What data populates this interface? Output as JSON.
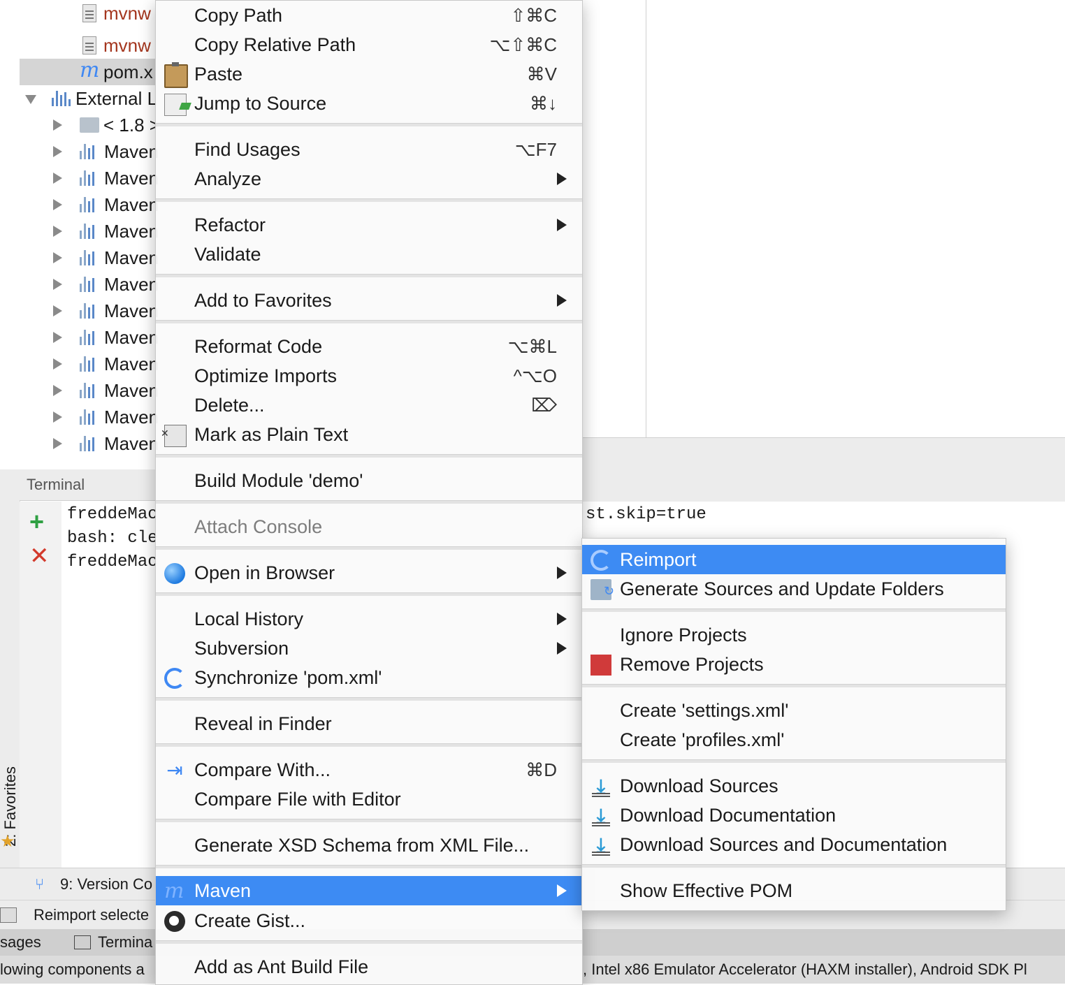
{
  "project_tree": {
    "rows": [
      {
        "label": "mvnw",
        "kind": "file",
        "style": "orange"
      },
      {
        "label": "mvnw",
        "kind": "file",
        "style": "orange"
      },
      {
        "label": "pom.x",
        "kind": "maven",
        "style": "normal",
        "selected": true
      },
      {
        "label": "External L",
        "kind": "lib-root",
        "style": "normal",
        "expanded": true
      },
      {
        "label": "< 1.8 >",
        "kind": "jdk",
        "style": "normal"
      },
      {
        "label": "Maven",
        "kind": "lib"
      },
      {
        "label": "Maven",
        "kind": "lib"
      },
      {
        "label": "Maven",
        "kind": "lib"
      },
      {
        "label": "Maven",
        "kind": "lib"
      },
      {
        "label": "Maven",
        "kind": "lib"
      },
      {
        "label": "Maven",
        "kind": "lib"
      },
      {
        "label": "Maven",
        "kind": "lib"
      },
      {
        "label": "Maven",
        "kind": "lib"
      },
      {
        "label": "Maven",
        "kind": "lib"
      },
      {
        "label": "Maven",
        "kind": "lib"
      },
      {
        "label": "Maven",
        "kind": "lib"
      },
      {
        "label": "Maven",
        "kind": "lib"
      }
    ]
  },
  "terminal": {
    "title": "Terminal",
    "lines": [
      "freddeMac",
      "bash: cle",
      "freddeMac"
    ],
    "right_text": "st.skip=true"
  },
  "bottom": {
    "version_control": "9: Version Co",
    "status": "Reimport selecte",
    "tab_messages": "sages",
    "tab_terminal": "Termina",
    "favorites": "2: Favorites",
    "notification": "lowing components a",
    "notification_right": ", Intel x86 Emulator Accelerator (HAXM installer), Android SDK Pl"
  },
  "context_menu": {
    "items": [
      {
        "label": "Copy Path",
        "shortcut": "⇧⌘C"
      },
      {
        "label": "Copy Relative Path",
        "shortcut": "⌥⇧⌘C"
      },
      {
        "label": "Paste",
        "shortcut": "⌘V",
        "icon": "paste-icon"
      },
      {
        "label": "Jump to Source",
        "shortcut": "⌘↓",
        "icon": "jump-to-source-icon"
      },
      {
        "label": "Find Usages",
        "shortcut": "⌥F7"
      },
      {
        "label": "Analyze",
        "submenu": true
      },
      {
        "label": "Refactor",
        "submenu": true
      },
      {
        "label": "Validate"
      },
      {
        "label": "Add to Favorites",
        "submenu": true
      },
      {
        "label": "Reformat Code",
        "shortcut": "⌥⌘L"
      },
      {
        "label": "Optimize Imports",
        "shortcut": "^⌥O"
      },
      {
        "label": "Delete...",
        "shortcut": "⌦"
      },
      {
        "label": "Mark as Plain Text",
        "icon": "plain-text-icon"
      },
      {
        "label": "Build Module 'demo'"
      },
      {
        "label": "Attach Console",
        "disabled": true
      },
      {
        "label": "Open in Browser",
        "submenu": true,
        "icon": "globe-icon"
      },
      {
        "label": "Local History",
        "submenu": true
      },
      {
        "label": "Subversion",
        "submenu": true
      },
      {
        "label": "Synchronize 'pom.xml'",
        "icon": "sync-icon"
      },
      {
        "label": "Reveal in Finder"
      },
      {
        "label": "Compare With...",
        "shortcut": "⌘D",
        "icon": "compare-icon"
      },
      {
        "label": "Compare File with Editor"
      },
      {
        "label": "Generate XSD Schema from XML File..."
      },
      {
        "label": "Maven",
        "submenu": true,
        "highlighted": true,
        "icon": "maven-icon"
      },
      {
        "label": "Create Gist...",
        "icon": "github-icon"
      },
      {
        "label": "Add as Ant Build File"
      }
    ]
  },
  "maven_submenu": {
    "items": [
      {
        "label": "Reimport",
        "highlighted": true,
        "icon": "reimport-icon"
      },
      {
        "label": "Generate Sources and Update Folders",
        "icon": "folder-sync-icon"
      },
      {
        "label": "Ignore Projects"
      },
      {
        "label": "Remove Projects",
        "icon": "remove-icon"
      },
      {
        "label": "Create 'settings.xml'"
      },
      {
        "label": "Create 'profiles.xml'"
      },
      {
        "label": "Download Sources",
        "icon": "download-icon"
      },
      {
        "label": "Download Documentation",
        "icon": "download-icon"
      },
      {
        "label": "Download Sources and Documentation",
        "icon": "download-icon"
      },
      {
        "label": "Show Effective POM"
      }
    ]
  },
  "colors": {
    "highlight": "#3d8bf3",
    "maven_blue": "#3f88f3",
    "file_orange": "#a4361e"
  }
}
